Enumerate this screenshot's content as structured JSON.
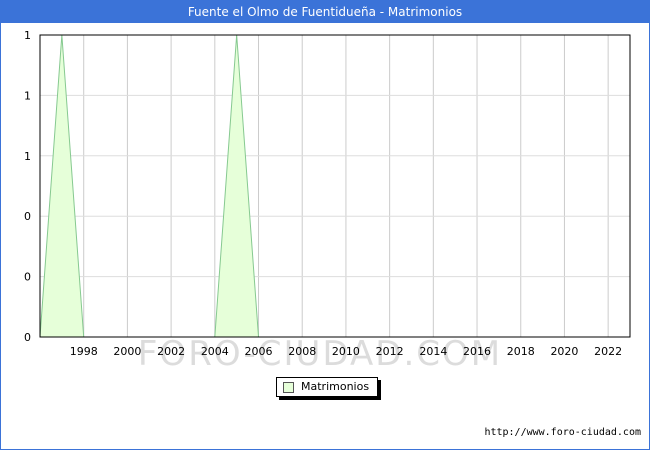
{
  "chart_data": {
    "type": "area",
    "title": "Fuente el Olmo de Fuentidueña - Matrimonios",
    "x": [
      1996,
      1997,
      1998,
      1999,
      2000,
      2001,
      2002,
      2003,
      2004,
      2005,
      2006,
      2007,
      2008,
      2009,
      2010,
      2011,
      2012,
      2013,
      2014,
      2015,
      2016,
      2017,
      2018,
      2019,
      2020,
      2021,
      2022
    ],
    "series": [
      {
        "name": "Matrimonios",
        "values": [
          0,
          1,
          0,
          0,
          0,
          0,
          0,
          0,
          0,
          1,
          0,
          0,
          0,
          0,
          0,
          0,
          0,
          0,
          0,
          0,
          0,
          0,
          0,
          0,
          0,
          0,
          0
        ],
        "color": "#e6ffd9",
        "line_color": "#86c990"
      }
    ],
    "xticks": [
      "1998",
      "2000",
      "2002",
      "2004",
      "2006",
      "2008",
      "2010",
      "2012",
      "2014",
      "2016",
      "2018",
      "2020",
      "2022"
    ],
    "yticks": [
      "0",
      "0",
      "0",
      "1",
      "1",
      "1"
    ],
    "xlim": [
      1996,
      2023
    ],
    "ylim": [
      0,
      1
    ],
    "grid": true,
    "legend_position": "bottom-center"
  },
  "watermark": "FORO-CIUDAD.COM",
  "source": "http://www.foro-ciudad.com"
}
